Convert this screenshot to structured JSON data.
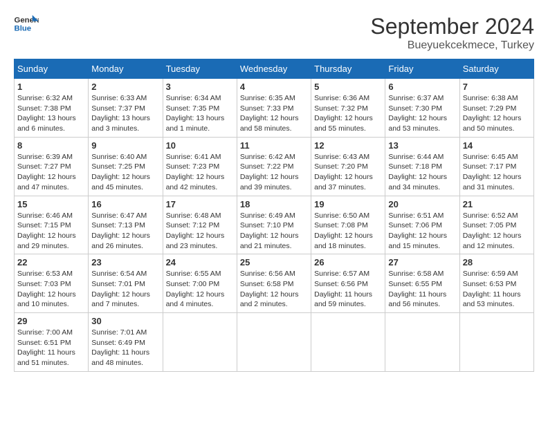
{
  "header": {
    "logo_line1": "General",
    "logo_line2": "Blue",
    "month": "September 2024",
    "location": "Bueyuekcekmece, Turkey"
  },
  "days_of_week": [
    "Sunday",
    "Monday",
    "Tuesday",
    "Wednesday",
    "Thursday",
    "Friday",
    "Saturday"
  ],
  "weeks": [
    [
      {
        "day": "1",
        "sunrise": "6:32 AM",
        "sunset": "7:38 PM",
        "daylight": "13 hours and 6 minutes."
      },
      {
        "day": "2",
        "sunrise": "6:33 AM",
        "sunset": "7:37 PM",
        "daylight": "13 hours and 3 minutes."
      },
      {
        "day": "3",
        "sunrise": "6:34 AM",
        "sunset": "7:35 PM",
        "daylight": "13 hours and 1 minute."
      },
      {
        "day": "4",
        "sunrise": "6:35 AM",
        "sunset": "7:33 PM",
        "daylight": "12 hours and 58 minutes."
      },
      {
        "day": "5",
        "sunrise": "6:36 AM",
        "sunset": "7:32 PM",
        "daylight": "12 hours and 55 minutes."
      },
      {
        "day": "6",
        "sunrise": "6:37 AM",
        "sunset": "7:30 PM",
        "daylight": "12 hours and 53 minutes."
      },
      {
        "day": "7",
        "sunrise": "6:38 AM",
        "sunset": "7:29 PM",
        "daylight": "12 hours and 50 minutes."
      }
    ],
    [
      {
        "day": "8",
        "sunrise": "6:39 AM",
        "sunset": "7:27 PM",
        "daylight": "12 hours and 47 minutes."
      },
      {
        "day": "9",
        "sunrise": "6:40 AM",
        "sunset": "7:25 PM",
        "daylight": "12 hours and 45 minutes."
      },
      {
        "day": "10",
        "sunrise": "6:41 AM",
        "sunset": "7:23 PM",
        "daylight": "12 hours and 42 minutes."
      },
      {
        "day": "11",
        "sunrise": "6:42 AM",
        "sunset": "7:22 PM",
        "daylight": "12 hours and 39 minutes."
      },
      {
        "day": "12",
        "sunrise": "6:43 AM",
        "sunset": "7:20 PM",
        "daylight": "12 hours and 37 minutes."
      },
      {
        "day": "13",
        "sunrise": "6:44 AM",
        "sunset": "7:18 PM",
        "daylight": "12 hours and 34 minutes."
      },
      {
        "day": "14",
        "sunrise": "6:45 AM",
        "sunset": "7:17 PM",
        "daylight": "12 hours and 31 minutes."
      }
    ],
    [
      {
        "day": "15",
        "sunrise": "6:46 AM",
        "sunset": "7:15 PM",
        "daylight": "12 hours and 29 minutes."
      },
      {
        "day": "16",
        "sunrise": "6:47 AM",
        "sunset": "7:13 PM",
        "daylight": "12 hours and 26 minutes."
      },
      {
        "day": "17",
        "sunrise": "6:48 AM",
        "sunset": "7:12 PM",
        "daylight": "12 hours and 23 minutes."
      },
      {
        "day": "18",
        "sunrise": "6:49 AM",
        "sunset": "7:10 PM",
        "daylight": "12 hours and 21 minutes."
      },
      {
        "day": "19",
        "sunrise": "6:50 AM",
        "sunset": "7:08 PM",
        "daylight": "12 hours and 18 minutes."
      },
      {
        "day": "20",
        "sunrise": "6:51 AM",
        "sunset": "7:06 PM",
        "daylight": "12 hours and 15 minutes."
      },
      {
        "day": "21",
        "sunrise": "6:52 AM",
        "sunset": "7:05 PM",
        "daylight": "12 hours and 12 minutes."
      }
    ],
    [
      {
        "day": "22",
        "sunrise": "6:53 AM",
        "sunset": "7:03 PM",
        "daylight": "12 hours and 10 minutes."
      },
      {
        "day": "23",
        "sunrise": "6:54 AM",
        "sunset": "7:01 PM",
        "daylight": "12 hours and 7 minutes."
      },
      {
        "day": "24",
        "sunrise": "6:55 AM",
        "sunset": "7:00 PM",
        "daylight": "12 hours and 4 minutes."
      },
      {
        "day": "25",
        "sunrise": "6:56 AM",
        "sunset": "6:58 PM",
        "daylight": "12 hours and 2 minutes."
      },
      {
        "day": "26",
        "sunrise": "6:57 AM",
        "sunset": "6:56 PM",
        "daylight": "11 hours and 59 minutes."
      },
      {
        "day": "27",
        "sunrise": "6:58 AM",
        "sunset": "6:55 PM",
        "daylight": "11 hours and 56 minutes."
      },
      {
        "day": "28",
        "sunrise": "6:59 AM",
        "sunset": "6:53 PM",
        "daylight": "11 hours and 53 minutes."
      }
    ],
    [
      {
        "day": "29",
        "sunrise": "7:00 AM",
        "sunset": "6:51 PM",
        "daylight": "11 hours and 51 minutes."
      },
      {
        "day": "30",
        "sunrise": "7:01 AM",
        "sunset": "6:49 PM",
        "daylight": "11 hours and 48 minutes."
      },
      null,
      null,
      null,
      null,
      null
    ]
  ],
  "labels": {
    "sunrise": "Sunrise:",
    "sunset": "Sunset:",
    "daylight": "Daylight:"
  }
}
